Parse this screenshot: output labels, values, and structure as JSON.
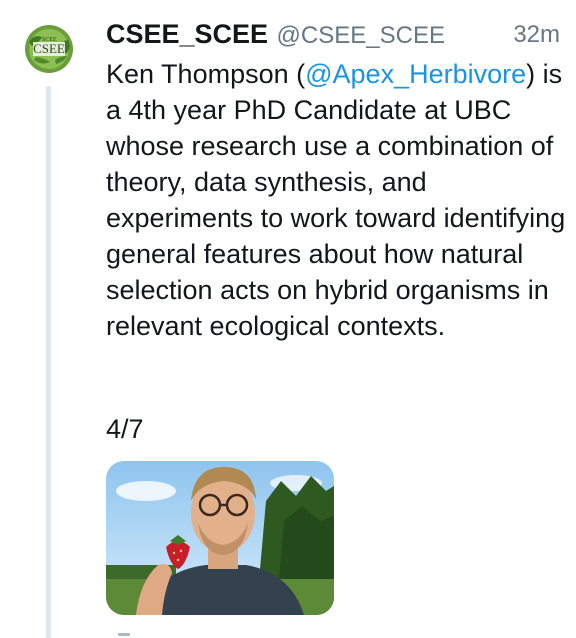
{
  "tweet": {
    "display_name": "CSEE_SCEE",
    "handle": "@CSEE_SCEE",
    "timestamp": "32m",
    "avatar_icon": "csee-scee-logo",
    "text_before": "Ken Thompson (",
    "mention": "@Apex_Herbivore",
    "text_after": ") is a 4th year PhD Candidate at UBC whose research use a combination of theory, data synthesis, and experiments to work toward identifying general features about how natural selection acts on hybrid organisms in relevant ecological contexts.",
    "thread_counter": "4/7",
    "media_icon": "photo-man-holding-strawberry"
  },
  "colors": {
    "text": "#14171a",
    "secondary": "#657786",
    "link": "#1b95e0",
    "thread_line": "#e1e8ed"
  }
}
